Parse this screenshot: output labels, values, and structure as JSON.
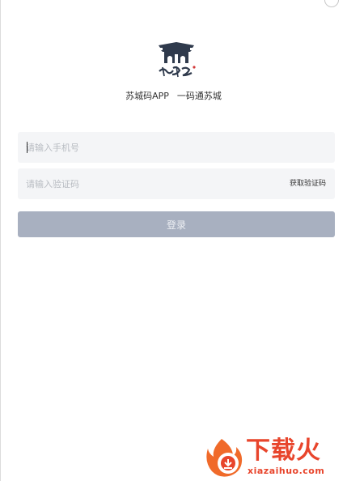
{
  "brand": {
    "logo_text": "蘇城码",
    "app_name": "苏城码APP",
    "slogan": "一码通苏城"
  },
  "login_form": {
    "phone_placeholder": "请输入手机号",
    "code_placeholder": "请输入验证码",
    "get_code_label": "获取验证码",
    "submit_label": "登录"
  },
  "watermark": {
    "title": "下载火",
    "url": "xiazaihuo.com"
  },
  "colors": {
    "login_button": "#a8b0c0",
    "input_background": "#f4f5f7",
    "logo_dark": "#2f3a4c",
    "watermark": "#e8452c"
  }
}
